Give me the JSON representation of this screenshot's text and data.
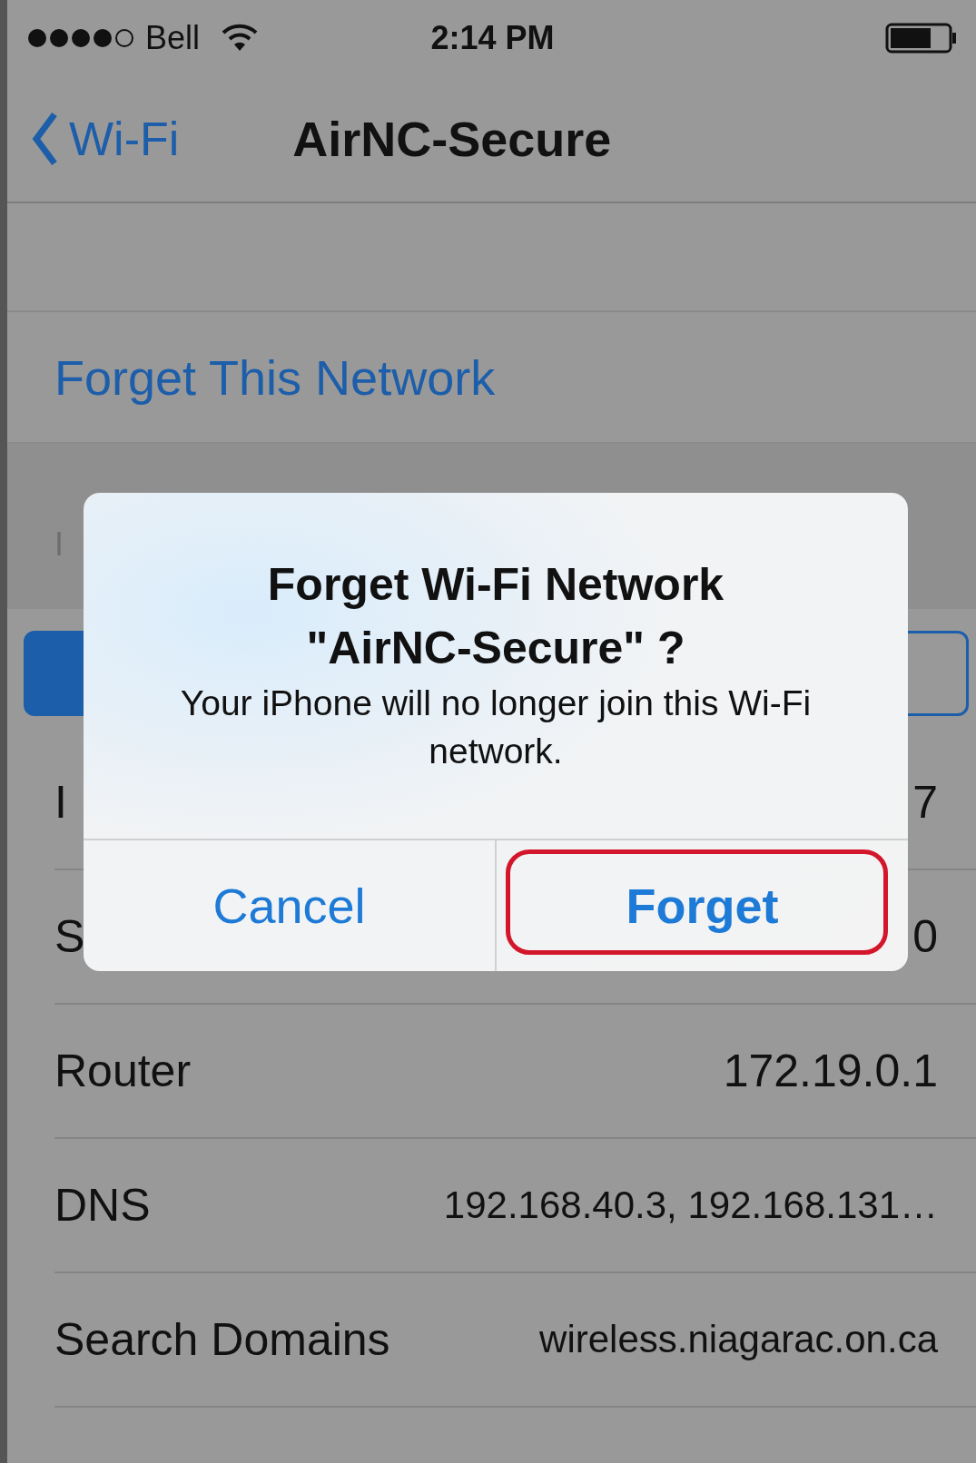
{
  "status_bar": {
    "carrier": "Bell",
    "time": "2:14 PM"
  },
  "nav_bar": {
    "back": "Wi-Fi",
    "title": "AirNC-Secure"
  },
  "forget_row": {
    "label": "Forget This Network"
  },
  "section_header": "I",
  "segmented": [
    {
      "selected": true
    },
    {
      "selected": false
    }
  ],
  "rows": [
    {
      "label": "I",
      "value": "7"
    },
    {
      "label": "S",
      "value": "0"
    },
    {
      "label": "Router",
      "value": "172.19.0.1"
    },
    {
      "label": "DNS",
      "value": "192.168.40.3, 192.168.131…"
    },
    {
      "label": "Search Domains",
      "value": "wireless.niagarac.on.ca"
    }
  ],
  "alert": {
    "title": "Forget Wi-Fi Network \"AirNC-Secure\" ?",
    "message": "Your iPhone will no longer join this Wi-Fi network.",
    "actions": [
      {
        "label": "Cancel",
        "kind": "cancel",
        "highlighted": false
      },
      {
        "label": "Forget",
        "kind": "default",
        "highlighted": true
      }
    ]
  }
}
